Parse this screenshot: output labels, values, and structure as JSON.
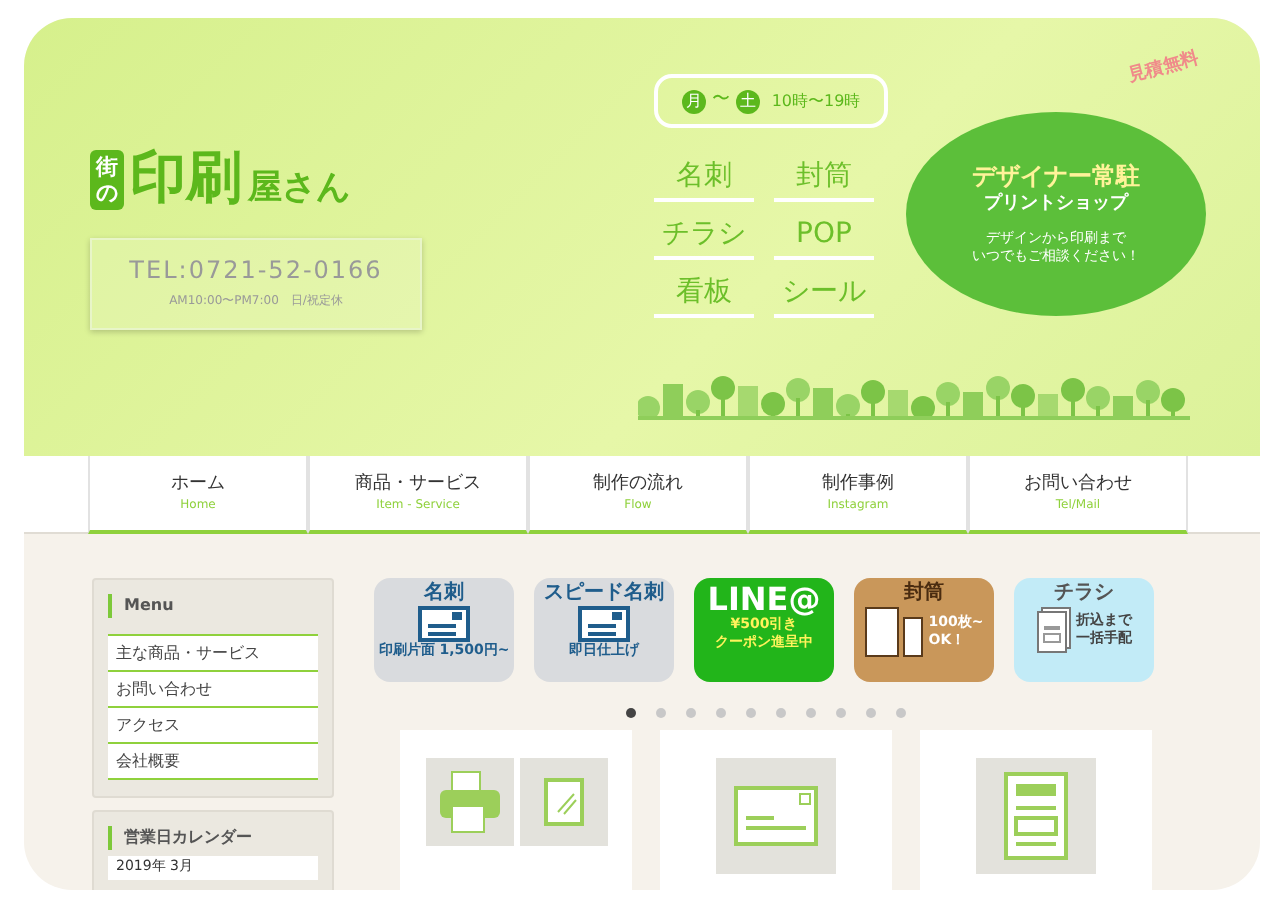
{
  "logo": {
    "badge": "街の",
    "main": "印刷",
    "sub": "屋さん"
  },
  "contact": {
    "tel": "TEL:0721-52-0166",
    "hours": "AM10:00〜PM7:00　日/祝定休"
  },
  "open_hours": {
    "days": [
      "月",
      "土"
    ],
    "separator": "〜",
    "time": "10時〜19時"
  },
  "products": [
    "名刺",
    "封筒",
    "チラシ",
    "POP",
    "看板",
    "シール"
  ],
  "promo": {
    "tag": "見積無料",
    "title": "デザイナー常駐",
    "subtitle": "プリントショップ",
    "text": [
      "デザインから印刷まで",
      "いつでもご相談ください！"
    ]
  },
  "nav": [
    {
      "label": "ホーム",
      "sub": "Home"
    },
    {
      "label": "商品・サービス",
      "sub": "Item - Service"
    },
    {
      "label": "制作の流れ",
      "sub": "Flow"
    },
    {
      "label": "制作事例",
      "sub": "Instagram"
    },
    {
      "label": "お問い合わせ",
      "sub": "Tel/Mail"
    }
  ],
  "sidebar": {
    "menu_title": "Menu",
    "items": [
      "主な商品・サービス",
      "お問い合わせ",
      "アクセス",
      "会社概要"
    ],
    "calendar_title": "営業日カレンダー",
    "calendar_month": "2019年 3月"
  },
  "banners": [
    {
      "kind": "card",
      "title": "名刺",
      "lines": [
        "印刷片面 1,500円~"
      ],
      "color": "#d9dbde"
    },
    {
      "kind": "speed",
      "title": "スピード名刺",
      "lines": [
        "即日仕上げ"
      ],
      "color": "#d9dbde"
    },
    {
      "kind": "line",
      "title": "LINE@",
      "lines": [
        "¥500引き",
        "クーポン進呈中"
      ],
      "color": "#22b51a"
    },
    {
      "kind": "envelope",
      "title": "封筒",
      "lines": [
        "100枚~",
        "OK！"
      ],
      "color": "#c9975a"
    },
    {
      "kind": "flyer",
      "title": "チラシ",
      "lines": [
        "折込まで",
        "一括手配"
      ],
      "color": "#c2ebf7"
    }
  ],
  "slider_dots": [
    {
      "selected": true
    },
    {
      "selected": false
    },
    {
      "selected": false
    },
    {
      "selected": false
    },
    {
      "selected": false
    },
    {
      "selected": false
    },
    {
      "selected": false
    },
    {
      "selected": false
    },
    {
      "selected": false
    },
    {
      "selected": false
    }
  ],
  "cards": [
    {
      "kind": "printer"
    },
    {
      "kind": "postcard"
    },
    {
      "kind": "flyer"
    }
  ]
}
